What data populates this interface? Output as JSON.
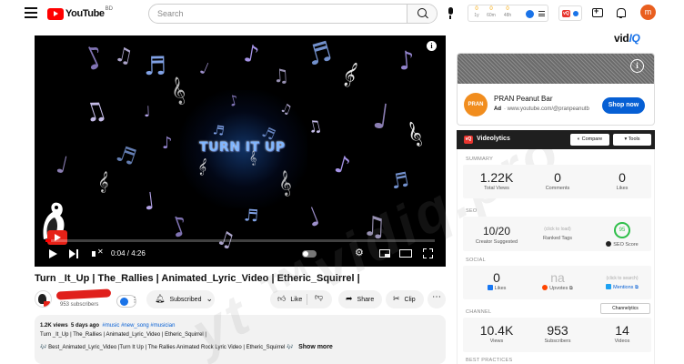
{
  "topbar": {
    "logo_text": "YouTube",
    "country_code": "BD",
    "search_placeholder": "Search",
    "avatar_letter": "m",
    "vidiq_stats": [
      {
        "value": "0",
        "label": "1y"
      },
      {
        "value": "0",
        "label": "60m"
      },
      {
        "value": "0",
        "label": "48h"
      }
    ],
    "vidiq_badge_text": "vQ"
  },
  "player": {
    "overlay_text": "TURN IT UP",
    "current_time": "0:04 / 4:26",
    "progress_fraction": 0.015,
    "gear_icon": "⚙"
  },
  "video": {
    "title": "Turn _It_Up | The_Rallies | Animated_Lyric_Video | Etheric_Squirrel |",
    "subscribers": "953 subscribers",
    "subscribe_label": "Subscribed",
    "like_label": "Like",
    "share_label": "Share",
    "clip_label": "Clip",
    "more_label": "⋯"
  },
  "description": {
    "views": "1.2K views",
    "age": "5 days ago",
    "tags": "#music #new_song #musician",
    "line1": "Turn _It_Up | The_Rallies | Animated_Lyric_Video | Etheric_Squirrel |",
    "line2": "🎶 Best_Animated_Lyric_Video |Turn It Up | The Rallies Animated Rock Lyric Video | Etheric_Squirrel 🎶",
    "show_more": "Show more"
  },
  "watermark": "yt ™vidiq.pro",
  "right": {
    "vidiq_logo_a": "vid",
    "vidiq_logo_b": "IQ",
    "ad": {
      "brand": "PRAN Peanut Bar",
      "logo_text": "PRAN",
      "label": "Ad",
      "url": "· www.youtube.com/@pranpeanutb",
      "cta": "Shop now"
    },
    "videolytics": {
      "title": "Videolytics",
      "logo_text": "vQ",
      "compare": "◐ Compare",
      "tools": "▾ Tools",
      "summary_label": "SUMMARY",
      "summary": [
        {
          "value": "1.22K",
          "label": "Total Views"
        },
        {
          "value": "0",
          "label": "Comments"
        },
        {
          "value": "0",
          "label": "Likes"
        }
      ],
      "seo_label": "SEO",
      "seo": {
        "suggested_value": "10/20",
        "suggested_label": "Creator Suggested",
        "ranked_hint": "(click to load)",
        "ranked_label": "Ranked Tags",
        "score_value": "95",
        "score_label": "SEO Score"
      },
      "social_label": "SOCIAL",
      "social": {
        "likes_value": "0",
        "likes_label": "Likes",
        "upvotes_value": "na",
        "upvotes_label": "Upvotes ⧉",
        "mentions_hint": "(click to search)",
        "mentions_label": "Mentions ⧉"
      },
      "channel_label": "CHANNEL",
      "channel_tools": "Channelytics",
      "channel": [
        {
          "value": "10.4K",
          "label": "Views"
        },
        {
          "value": "953",
          "label": "Subscribers"
        },
        {
          "value": "14",
          "label": "Videos"
        }
      ],
      "best_practices_label": "BEST PRACTICES"
    }
  },
  "colors": {
    "youtube_red": "#ff0000",
    "vidiq_blue": "#1a73e8",
    "link_blue": "#065fd4",
    "seo_green": "#2fbf4a"
  }
}
